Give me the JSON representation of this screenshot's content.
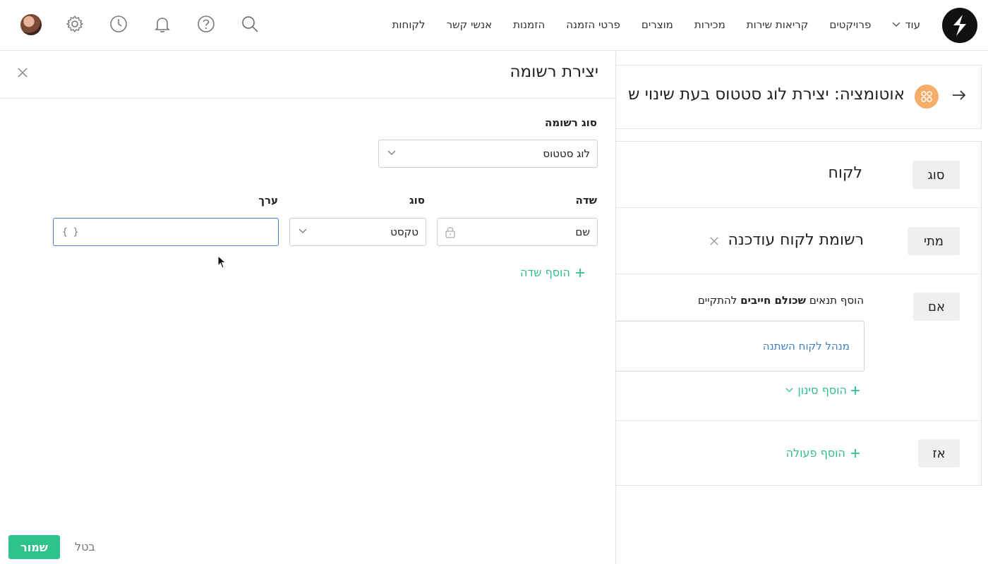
{
  "nav": {
    "items": [
      "לקוחות",
      "אנשי קשר",
      "הזמנות",
      "פרטי הזמנה",
      "מוצרים",
      "מכירות",
      "קריאות שירות",
      "פרויקטים"
    ],
    "more_label": "עוד"
  },
  "icons": {
    "search": "search-icon",
    "help": "help-icon",
    "bell": "bell-icon",
    "history": "clock-icon",
    "settings": "gear-icon"
  },
  "automation": {
    "title": "אוטומציה: יצירת לוג סטטוס בעת שינוי ש",
    "rows": {
      "type": {
        "chip": "סוג",
        "value": "לקוח"
      },
      "when": {
        "chip": "מתי",
        "value": "רשומת לקוח עודכנה"
      },
      "if": {
        "chip": "אם",
        "hint_prefix": "הוסף תנאים",
        "hint_bold": "שכולם חייבים",
        "hint_suffix": "להתקיים",
        "condition": "מנהל לקוח השתנה",
        "add_filter": "הוסף סינון"
      },
      "then": {
        "chip": "אז",
        "add_action": "הוסף פעולה"
      }
    }
  },
  "drawer": {
    "title": "יצירת רשומה",
    "record_type_label": "סוג רשומה",
    "record_type_value": "לוג סטטוס",
    "field_col": "שדה",
    "type_col": "סוג",
    "value_col": "ערך",
    "field_value": "שם",
    "type_value": "טקסט",
    "value_placeholder": "{ }",
    "add_field": "הוסף שדה",
    "save": "שמור",
    "cancel": "בטל"
  },
  "colors": {
    "accent": "#2ec28d",
    "link": "#3d7fc6",
    "badge": "#f6ad6a"
  }
}
